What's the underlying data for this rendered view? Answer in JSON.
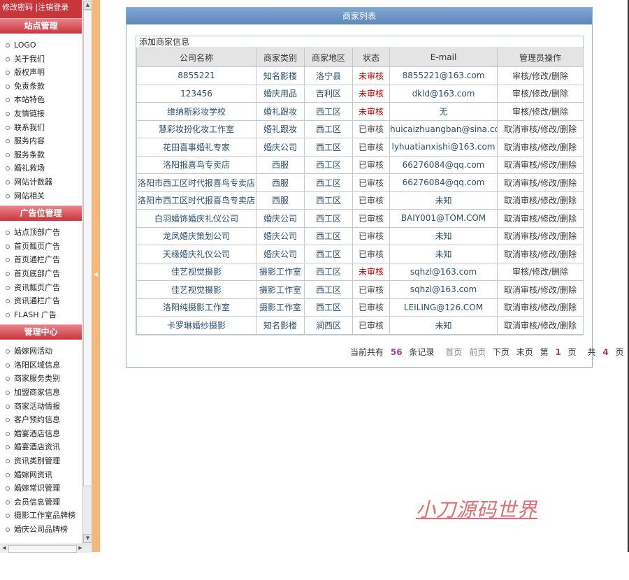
{
  "sidebar": {
    "top_links": [
      "修改密码",
      "|注销登录"
    ],
    "sections": [
      {
        "title": "站点管理",
        "items": [
          "LOGO",
          "关于我们",
          "版权声明",
          "免责条款",
          "本站特色",
          "友情链接",
          "联系我们",
          "服务内容",
          "服务条款",
          "婚礼救场",
          "网站计数器",
          "网站相关"
        ]
      },
      {
        "title": "广告位管理",
        "items": [
          "站点顶部广告",
          "首页瓢页广告",
          "首页通栏广告",
          "首页底部广告",
          "资讯瓢页广告",
          "资讯通栏广告",
          "FLASH 广告"
        ]
      },
      {
        "title": "管理中心",
        "items": [
          "婚嫁网活动",
          "洛阳区域信息",
          "商家服务类别",
          "加盟商家信息",
          "商家活动情报",
          "客户预约信息",
          "婚宴酒店信息",
          "婚宴酒店资讯",
          "资讯类别管理",
          "婚嫁网资讯",
          "婚嫁常识管理",
          "会员信息管理",
          "摄影工作室品牌榜",
          "婚庆公司品牌榜"
        ]
      }
    ]
  },
  "panel": {
    "title": "商家列表",
    "add_link": "添加商家信息",
    "columns": [
      "公司名称",
      "商家类别",
      "商家地区",
      "状态",
      "E-mail",
      "管理员操作"
    ],
    "rows": [
      {
        "name": "8855221",
        "category": "知名影楼",
        "area": "洛宁县",
        "status": "未审核",
        "email": "8855221@163.com",
        "ops": "审核/修改/删除"
      },
      {
        "name": "123456",
        "category": "婚庆用品",
        "area": "吉利区",
        "status": "未审核",
        "email": "dkld@163.com",
        "ops": "审核/修改/删除"
      },
      {
        "name": "维纳斯彩妆学校",
        "category": "婚礼跟妆",
        "area": "西工区",
        "status": "未审核",
        "email": "无",
        "ops": "审核/修改/删除"
      },
      {
        "name": "慧彩妆扮化妆工作室",
        "category": "婚礼跟妆",
        "area": "西工区",
        "status": "已审核",
        "email": "huicaizhuangban@sina.com",
        "ops": "取消审核/修改/删除"
      },
      {
        "name": "花田喜事婚礼专家",
        "category": "婚庆公司",
        "area": "西工区",
        "status": "已审核",
        "email": "lyhuatianxishi@163.com",
        "ops": "取消审核/修改/删除"
      },
      {
        "name": "洛阳报喜鸟专卖店",
        "category": "西服",
        "area": "西工区",
        "status": "已审核",
        "email": "66276084@qq.com",
        "ops": "取消审核/修改/删除"
      },
      {
        "name": "洛阳市西工区时代报喜鸟专卖店",
        "category": "西服",
        "area": "西工区",
        "status": "已审核",
        "email": "66276084@qq.com",
        "ops": "取消审核/修改/删除"
      },
      {
        "name": "洛阳市西工区时代报喜鸟专卖店",
        "category": "西服",
        "area": "西工区",
        "status": "已审核",
        "email": "未知",
        "ops": "取消审核/修改/删除"
      },
      {
        "name": "白羽婚饰婚庆礼仪公司",
        "category": "婚庆公司",
        "area": "西工区",
        "status": "已审核",
        "email": "BAIY001@TOM.COM",
        "ops": "取消审核/修改/删除"
      },
      {
        "name": "龙凤婚庆策划公司",
        "category": "婚庆公司",
        "area": "西工区",
        "status": "已审核",
        "email": "未知",
        "ops": "取消审核/修改/删除"
      },
      {
        "name": "天缘婚庆礼仪公司",
        "category": "婚庆公司",
        "area": "西工区",
        "status": "已审核",
        "email": "未知",
        "ops": "取消审核/修改/删除"
      },
      {
        "name": "佳艺视觉摄影",
        "category": "摄影工作室",
        "area": "西工区",
        "status": "未审核",
        "email": "sqhzl@163.com",
        "ops": "审核/修改/删除"
      },
      {
        "name": "佳艺视觉摄影",
        "category": "摄影工作室",
        "area": "西工区",
        "status": "已审核",
        "email": "sqhzl@163.com",
        "ops": "取消审核/修改/删除"
      },
      {
        "name": "洛阳纯摄影工作室",
        "category": "摄影工作室",
        "area": "西工区",
        "status": "已审核",
        "email": "LEILING@126.COM",
        "ops": "取消审核/修改/删除"
      },
      {
        "name": "卡罗琳婚纱摄影",
        "category": "知名影楼",
        "area": "涧西区",
        "status": "已审核",
        "email": "未知",
        "ops": "取消审核/修改/删除"
      }
    ],
    "pager": {
      "total_prefix": "当前共有",
      "total": "56",
      "total_suffix": "条记录",
      "first": "首页",
      "prev": "前页",
      "next": "下页",
      "last": "末页",
      "page_prefix": "第",
      "page": "1",
      "page_suffix": "页",
      "pages_prefix": "共",
      "pages": "4",
      "pages_suffix": "页"
    }
  },
  "watermark": "小刀源码世界",
  "colors": {
    "sidebar_header": "#c9363d",
    "panel_header": "#6e96c8",
    "divider": "#f6b77a",
    "pending": "#c00000"
  }
}
